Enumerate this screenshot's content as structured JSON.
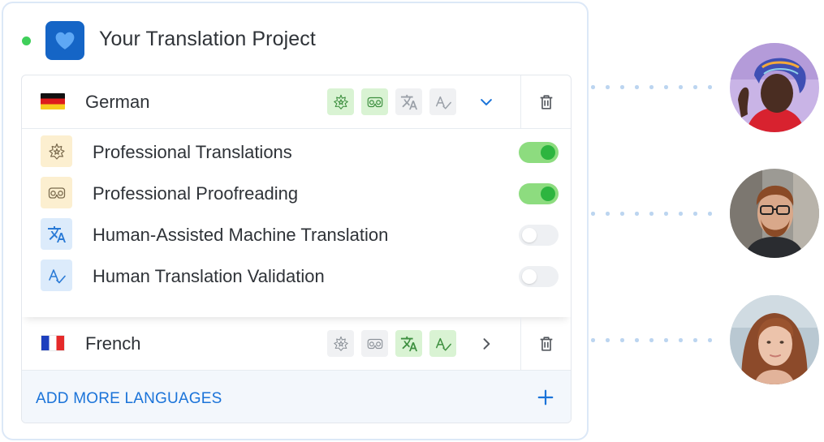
{
  "project": {
    "title": "Your Translation Project",
    "status_color": "#3fcf5a",
    "logo_icon": "heart-icon"
  },
  "languages": [
    {
      "name": "German",
      "flag": "flag-germany",
      "expanded": true,
      "service_icons": [
        {
          "icon": "sparkle-star-icon",
          "active": true
        },
        {
          "icon": "glasses-icon",
          "active": true
        },
        {
          "icon": "translate-icon",
          "active": false
        },
        {
          "icon": "spellcheck-icon",
          "active": false
        }
      ],
      "expand_icon": "chevron-down-icon",
      "delete_icon": "trash-icon"
    },
    {
      "name": "French",
      "flag": "flag-france",
      "expanded": false,
      "service_icons": [
        {
          "icon": "sparkle-star-icon",
          "active": false
        },
        {
          "icon": "glasses-icon",
          "active": false
        },
        {
          "icon": "translate-icon",
          "active": true
        },
        {
          "icon": "spellcheck-icon",
          "active": true
        }
      ],
      "expand_icon": "chevron-right-icon",
      "delete_icon": "trash-icon"
    }
  ],
  "services": [
    {
      "label": "Professional Translations",
      "icon": "sparkle-star-icon",
      "enabled": true
    },
    {
      "label": "Professional Proofreading",
      "icon": "glasses-icon",
      "enabled": true
    },
    {
      "label": "Human-Assisted Machine Translation",
      "icon": "translate-icon",
      "enabled": false
    },
    {
      "label": "Human Translation Validation",
      "icon": "spellcheck-icon",
      "enabled": false
    }
  ],
  "add_languages": {
    "label": "ADD MORE LANGUAGES",
    "icon": "plus-icon"
  },
  "colors": {
    "accent": "#1a73d9",
    "toggle_on": "#2db53f",
    "active_icon_bg": "#d9f3d3"
  },
  "translators": [
    {
      "avatar": "translator-avatar-1"
    },
    {
      "avatar": "translator-avatar-2"
    },
    {
      "avatar": "translator-avatar-3"
    }
  ]
}
